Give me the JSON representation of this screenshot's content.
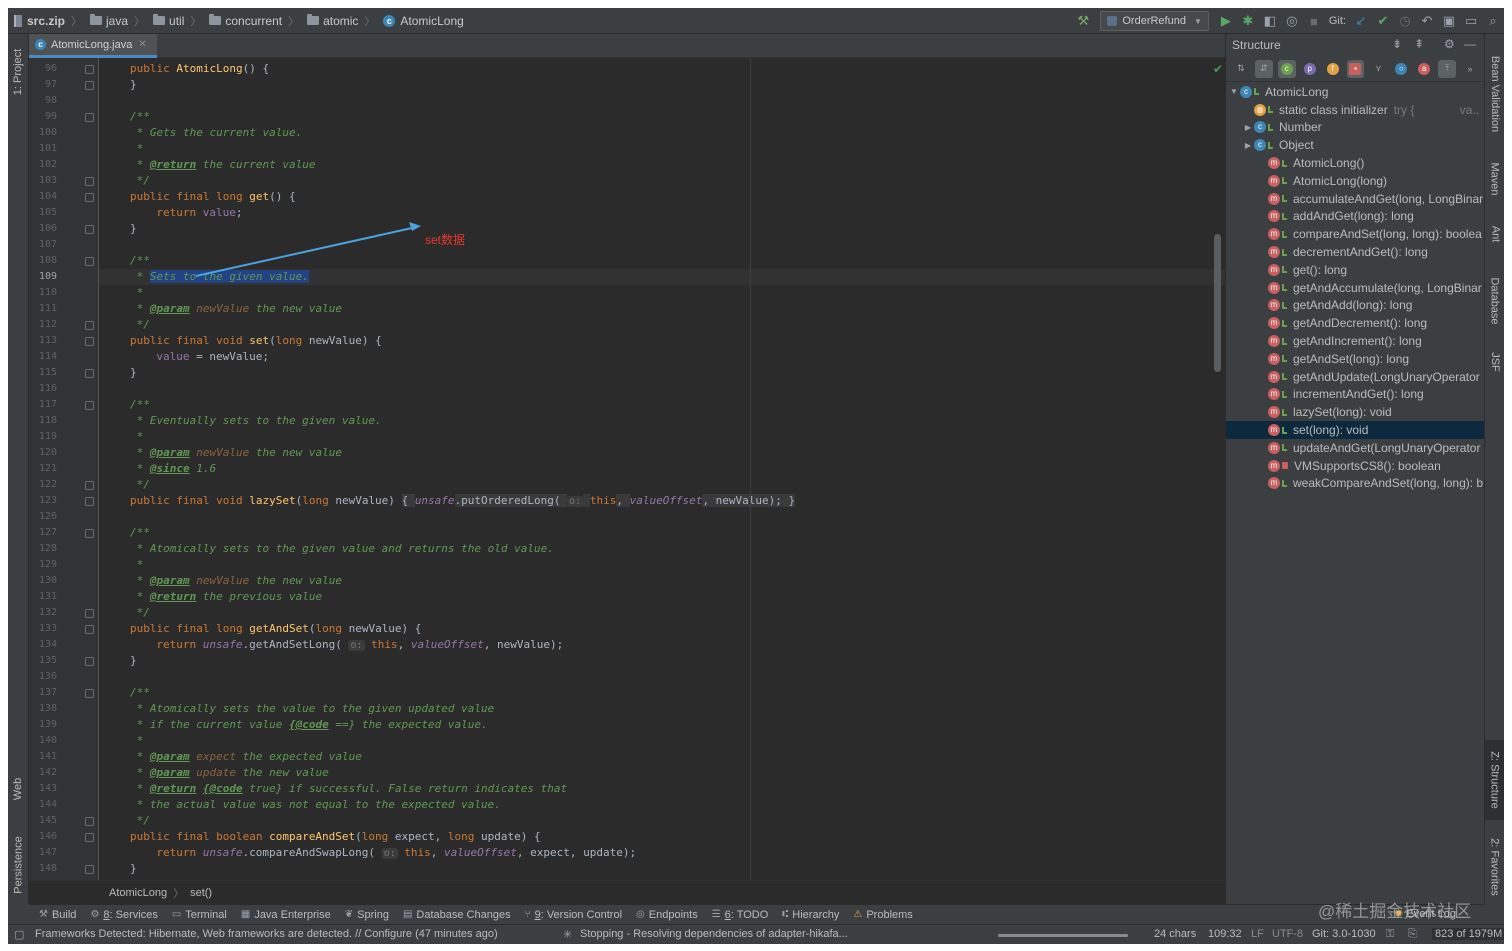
{
  "navbar": {
    "crumbs": [
      "src.zip",
      "java",
      "util",
      "concurrent",
      "atomic",
      "AtomicLong"
    ],
    "run_config": "OrderRefund",
    "git_label": "Git:"
  },
  "left_tabs": {
    "project": "1: Project",
    "web": "Web",
    "persistence": "Persistence"
  },
  "editor": {
    "tab_label": "AtomicLong.java",
    "annotation": "set数据",
    "current_line": "109",
    "breadcrumb": [
      "AtomicLong",
      "set()"
    ],
    "line_numbers": [
      "96",
      "97",
      "98",
      "99",
      "100",
      "101",
      "102",
      "103",
      "104",
      "105",
      "106",
      "107",
      "108",
      "109",
      "110",
      "111",
      "112",
      "113",
      "114",
      "115",
      "116",
      "117",
      "118",
      "119",
      "120",
      "121",
      "122",
      "123",
      "126",
      "127",
      "128",
      "129",
      "130",
      "131",
      "132",
      "133",
      "134",
      "135",
      "136",
      "137",
      "138",
      "139",
      "140",
      "141",
      "142",
      "143",
      "144",
      "145",
      "146",
      "147",
      "148"
    ],
    "lines": {
      "l96": [
        "public ",
        "AtomicLong",
        "() {"
      ],
      "l97": "}",
      "l99": "/**",
      "l100": " * Gets the current value.",
      "l101": " *",
      "l102": [
        " * ",
        "@return",
        " the current value"
      ],
      "l103": " */",
      "l104": [
        "public final long ",
        "get",
        "() {"
      ],
      "l105": [
        "return ",
        "value",
        ";"
      ],
      "l106": "}",
      "l108": "/**",
      "l109": [
        " * ",
        "Sets to the given value."
      ],
      "l110": " *",
      "l111": [
        " * ",
        "@param",
        " ",
        "newValue",
        " the new value"
      ],
      "l112": " */",
      "l113": [
        "public final void ",
        "set",
        "(",
        "long",
        " newValue) {"
      ],
      "l114": [
        "value",
        " = newValue;"
      ],
      "l115": "}",
      "l117": "/**",
      "l118": " * Eventually sets to the given value.",
      "l119": " *",
      "l120": [
        " * ",
        "@param",
        " ",
        "newValue",
        " the new value"
      ],
      "l121": [
        " * ",
        "@since",
        " 1.6"
      ],
      "l122": " */",
      "l123": [
        "public final void ",
        "lazySet",
        "(",
        "long",
        " newValue) ",
        "{ ",
        "unsafe",
        ".putOrderedLong( ",
        "o:",
        " ",
        "this",
        ", ",
        "valueOffset",
        ", newValue); }"
      ],
      "l127": "/**",
      "l128": " * Atomically sets to the given value and returns the old value.",
      "l129": " *",
      "l130": [
        " * ",
        "@param",
        " ",
        "newValue",
        " the new value"
      ],
      "l131": [
        " * ",
        "@return",
        " the previous value"
      ],
      "l132": " */",
      "l133": [
        "public final long ",
        "getAndSet",
        "(",
        "long",
        " newValue) {"
      ],
      "l134": [
        "return ",
        "unsafe",
        ".getAndSetLong( ",
        "o:",
        " ",
        "this",
        ", ",
        "valueOffset",
        ", newValue);"
      ],
      "l135": "}",
      "l137": "/**",
      "l138": " * Atomically sets the value to the given updated value",
      "l139": [
        " * if the current value ",
        "{@code",
        " ==} the expected value."
      ],
      "l140": " *",
      "l141": [
        " * ",
        "@param",
        " ",
        "expect",
        " the expected value"
      ],
      "l142": [
        " * ",
        "@param",
        " ",
        "update",
        " the new value"
      ],
      "l143": [
        " * ",
        "@return",
        " ",
        "{@code",
        " true} if successful. False return indicates that"
      ],
      "l144": " * the actual value was not equal to the expected value.",
      "l145": " */",
      "l146": [
        "public final boolean ",
        "compareAndSet",
        "(",
        "long",
        " expect, ",
        "long",
        " update) {"
      ],
      "l147": [
        "return ",
        "unsafe",
        ".compareAndSwapLong( ",
        "o:",
        " ",
        "this",
        ", ",
        "valueOffset",
        ", expect, update);"
      ],
      "l148": "}"
    }
  },
  "structure": {
    "title": "Structure",
    "items": [
      "AtomicLong",
      "static class initializer",
      "Number",
      "Object",
      "AtomicLong()",
      "AtomicLong(long)",
      "accumulateAndGet(long, LongBinar",
      "addAndGet(long): long",
      "compareAndSet(long, long): boolea",
      "decrementAndGet(): long",
      "get(): long",
      "getAndAccumulate(long, LongBinar",
      "getAndAdd(long): long",
      "getAndDecrement(): long",
      "getAndIncrement(): long",
      "getAndSet(long): long",
      "getAndUpdate(LongUnaryOperator",
      "incrementAndGet(): long",
      "lazySet(long): void",
      "set(long): void",
      "updateAndGet(LongUnaryOperator",
      "VMSupportsCS8(): boolean",
      "weakCompareAndSet(long, long): b"
    ],
    "initializer_hint": "try {",
    "initializer_hint_right": "va..",
    "selected": "set(long): void"
  },
  "right_tabs": {
    "bean": "Bean Validation",
    "maven": "Maven",
    "ant": "Ant",
    "database": "Database",
    "jsf": "JSF",
    "structure": "Z: Structure",
    "favorites": "2: Favorites"
  },
  "tool_buttons": [
    {
      "num": "",
      "label": "Build"
    },
    {
      "num": "8",
      "label": ": Services"
    },
    {
      "num": "",
      "label": "Terminal"
    },
    {
      "num": "",
      "label": "Java Enterprise"
    },
    {
      "num": "",
      "label": "Spring"
    },
    {
      "num": "",
      "label": "Database Changes"
    },
    {
      "num": "9",
      "label": ": Version Control"
    },
    {
      "num": "",
      "label": "Endpoints"
    },
    {
      "num": "6",
      "label": ": TODO"
    },
    {
      "num": "",
      "label": "Hierarchy"
    },
    {
      "num": "",
      "label": "Problems"
    }
  ],
  "event_log": "Event Log",
  "status": {
    "message": "Frameworks Detected: Hibernate, Web frameworks are detected. // Configure (47 minutes ago)",
    "task": "Stopping - Resolving dependencies of adapter-hikafa...",
    "chars": "24 chars",
    "position": "109:32",
    "line_sep": "LF",
    "encoding": "UTF-8",
    "git": "Git: 3.0-1030",
    "memory": "823 of 1979M"
  },
  "watermark": "@稀土掘金技术社区",
  "colors": {
    "keyword": "#cc7832",
    "method": "#ffc66d",
    "field": "#9876aa",
    "comment": "#629755",
    "annotation": "#e8382f",
    "selection": "#214283"
  }
}
